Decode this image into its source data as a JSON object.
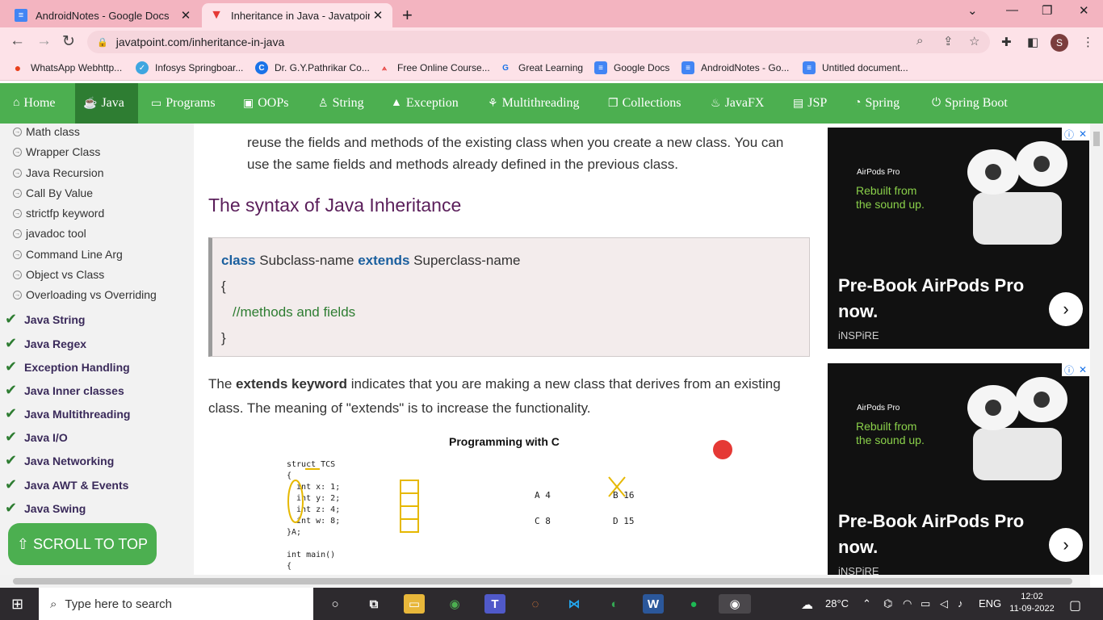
{
  "browser": {
    "tabs": [
      {
        "title": "AndroidNotes - Google Docs"
      },
      {
        "title": "Inheritance in Java - Javatpoint"
      }
    ],
    "url": "javatpoint.com/inheritance-in-java",
    "profile_initial": "S",
    "bookmarks": [
      "WhatsApp Webhttp...",
      "Infosys Springboar...",
      "Dr. G.Y.Pathrikar Co...",
      "Free Online Course...",
      "Great Learning",
      "Google Docs",
      "AndroidNotes - Go...",
      "Untitled document..."
    ]
  },
  "site_nav": [
    {
      "label": "Home",
      "icon": "home-icon"
    },
    {
      "label": "Java",
      "icon": "java-cup-icon"
    },
    {
      "label": "Programs",
      "icon": "monitor-icon"
    },
    {
      "label": "OOPs",
      "icon": "oops-icon"
    },
    {
      "label": "String",
      "icon": "string-icon"
    },
    {
      "label": "Exception",
      "icon": "warning-icon"
    },
    {
      "label": "Multithreading",
      "icon": "threads-icon"
    },
    {
      "label": "Collections",
      "icon": "collections-icon"
    },
    {
      "label": "JavaFX",
      "icon": "javafx-icon"
    },
    {
      "label": "JSP",
      "icon": "jsp-icon"
    },
    {
      "label": "Spring",
      "icon": "spring-icon"
    },
    {
      "label": "Spring Boot",
      "icon": "spring-boot-icon"
    }
  ],
  "sidebar": {
    "items": [
      "Math class",
      "Wrapper Class",
      "Java Recursion",
      "Call By Value",
      "strictfp keyword",
      "javadoc tool",
      "Command Line Arg",
      "Object vs Class",
      "Overloading vs Overriding"
    ],
    "groups": [
      "Java String",
      "Java Regex",
      "Exception Handling",
      "Java Inner classes",
      "Java Multithreading",
      "Java I/O",
      "Java Networking",
      "Java AWT & Events",
      "Java Swing"
    ],
    "scroll_to_top": "⇧ SCROLL TO TOP"
  },
  "article": {
    "para1_line1": "reuse the fields and methods of the existing class when you create a new class. You can",
    "para1_line2": "use the same fields and methods already defined in the previous class.",
    "heading": "The syntax of Java Inheritance",
    "code": {
      "kw_class": "class",
      "subclass": "Subclass-name",
      "kw_extends": "extends",
      "superclass": "Superclass-name",
      "open_brace": "{",
      "comment": "//methods and fields",
      "close_brace": "}"
    },
    "para2_pre": "The ",
    "para2_bold": "extends keyword",
    "para2_post": " indicates that you are making a new class that derives from an existing class. The meaning of \"extends\" is to increase the functionality.",
    "image": {
      "title": "Programming with C",
      "code": "struct TCS\n{\n  int x: 1;\n  int y: 2;\n  int z: 4;\n  int w: 8;\n}A;\n\nint main()\n{",
      "notes": [
        "A  4",
        "B  16",
        "C  8",
        "D  15"
      ]
    }
  },
  "ads": [
    {
      "brand": "AirPods Pro",
      "tagline_1": "Rebuilt from",
      "tagline_2": "the sound up.",
      "headline_1": "Pre-Book AirPods Pro",
      "headline_2": "now.",
      "source": "iNSPiRE"
    },
    {
      "brand": "AirPods Pro",
      "tagline_1": "Rebuilt from",
      "tagline_2": "the sound up.",
      "headline_1": "Pre-Book AirPods Pro",
      "headline_2": "now.",
      "source": "iNSPiRE"
    }
  ],
  "taskbar": {
    "search_placeholder": "Type here to search",
    "weather": "28°C",
    "language": "ENG",
    "time": "12:02",
    "date": "11-09-2022"
  }
}
